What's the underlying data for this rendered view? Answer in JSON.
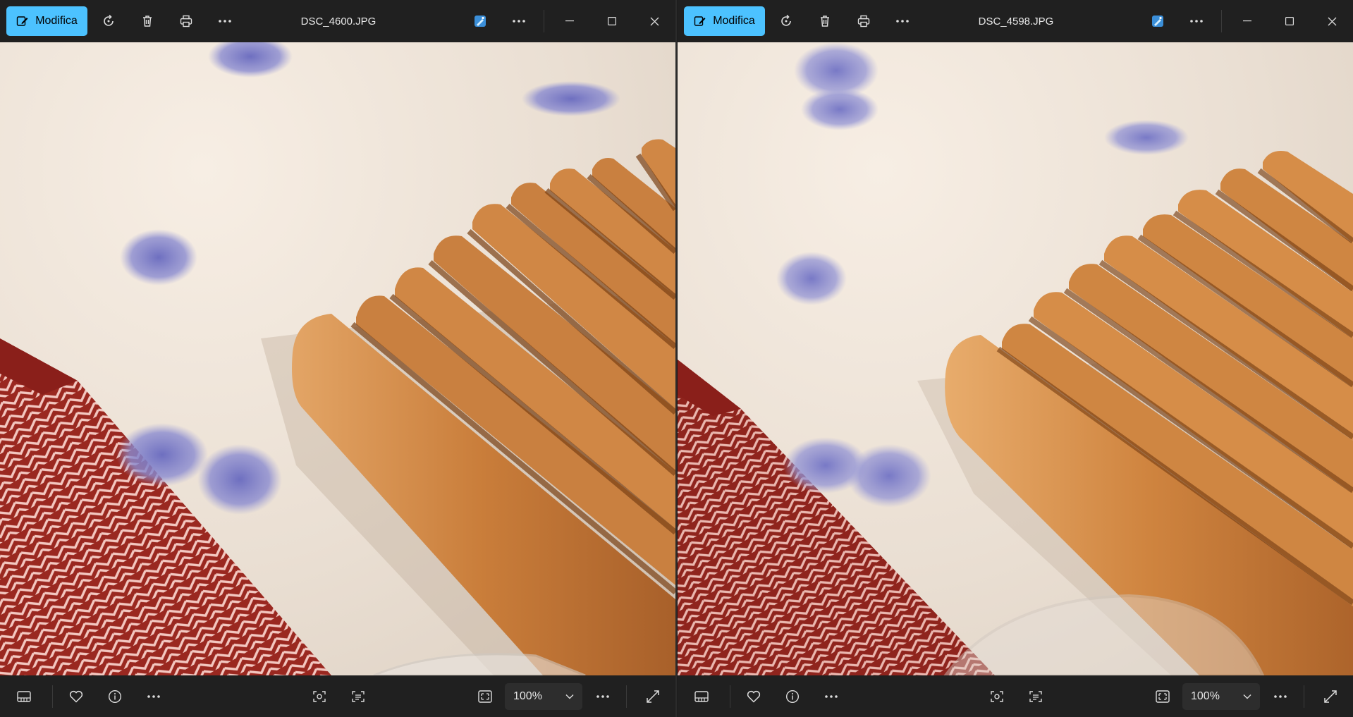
{
  "windows": [
    {
      "id": "left",
      "title": "DSC_4600.JPG",
      "edit_label": "Modifica",
      "zoom_value": "100%"
    },
    {
      "id": "right",
      "title": "DSC_4598.JPG",
      "edit_label": "Modifica",
      "zoom_value": "100%"
    }
  ],
  "colors": {
    "accent": "#4cc2ff",
    "chrome": "#202020",
    "wood": "#c97e3c",
    "pattern_red": "#9c2a22"
  },
  "icons": [
    "edit-icon",
    "rotate-icon",
    "delete-icon",
    "print-icon",
    "more-icon",
    "editor-app-icon",
    "minimize-icon",
    "maximize-icon",
    "close-icon",
    "filmstrip-icon",
    "favorite-icon",
    "info-icon",
    "face-scan-icon",
    "text-scan-icon",
    "fit-to-window-icon",
    "chevron-down-icon",
    "fullscreen-icon"
  ]
}
